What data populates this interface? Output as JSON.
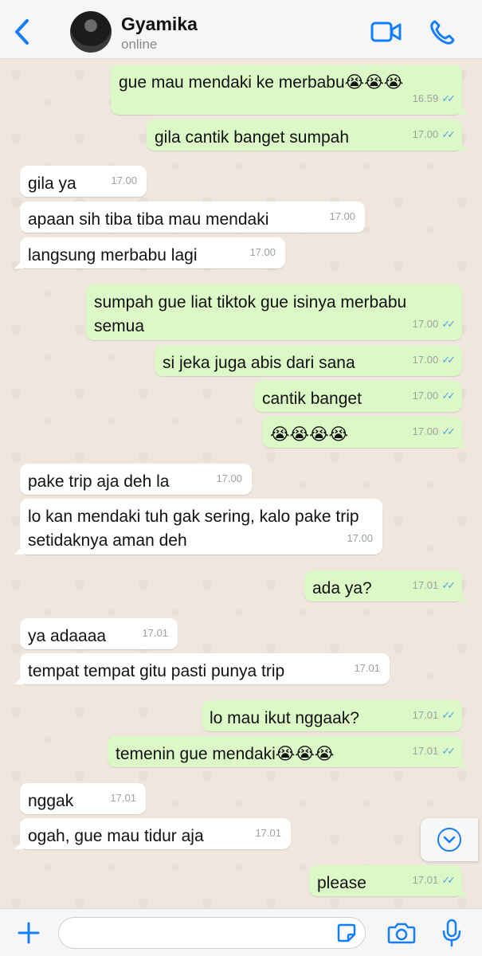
{
  "header": {
    "contact_name": "Gyamika",
    "status": "online",
    "icons": [
      "back-chevron-icon",
      "video-call-icon",
      "phone-call-icon"
    ]
  },
  "messages": [
    {
      "dir": "out",
      "text": "gue mau mendaki ke merbabu😭😭😭",
      "time": "16.59"
    },
    {
      "dir": "out",
      "text": "gila cantik banget sumpah",
      "time": "17.00"
    },
    {
      "dir": "in",
      "text": "gila ya",
      "time": "17.00"
    },
    {
      "dir": "in",
      "text": "apaan sih tiba tiba mau mendaki",
      "time": "17.00"
    },
    {
      "dir": "in",
      "text": "langsung merbabu lagi",
      "time": "17.00"
    },
    {
      "dir": "out",
      "text": "sumpah gue liat tiktok gue isinya merbabu semua",
      "time": "17.00"
    },
    {
      "dir": "out",
      "text": "si jeka juga abis dari sana",
      "time": "17.00"
    },
    {
      "dir": "out",
      "text": "cantik banget",
      "time": "17.00"
    },
    {
      "dir": "out",
      "text": "😭😭😭😭",
      "time": "17.00"
    },
    {
      "dir": "in",
      "text": "pake trip aja deh la",
      "time": "17.00"
    },
    {
      "dir": "in",
      "text": "lo kan mendaki tuh gak sering, kalo pake trip setidaknya aman deh",
      "time": "17.00"
    },
    {
      "dir": "out",
      "text": "ada ya?",
      "time": "17.01"
    },
    {
      "dir": "in",
      "text": "ya adaaaa",
      "time": "17.01"
    },
    {
      "dir": "in",
      "text": "tempat tempat gitu pasti punya trip",
      "time": "17.01"
    },
    {
      "dir": "out",
      "text": "lo mau ikut nggaak?",
      "time": "17.01"
    },
    {
      "dir": "out",
      "text": "temenin gue mendaki😭😭😭",
      "time": "17.01"
    },
    {
      "dir": "in",
      "text": "nggak",
      "time": "17.01"
    },
    {
      "dir": "in",
      "text": "ogah, gue mau tidur aja",
      "time": "17.01"
    },
    {
      "dir": "out",
      "text": "please",
      "time": "17.01"
    }
  ],
  "read_ticks": "✓✓",
  "colors": {
    "accent": "#147efb",
    "outgoing_bubble": "#dcf8c6",
    "incoming_bubble": "#ffffff",
    "read_ticks": "#53a3e6",
    "wallpaper": "#efe7de"
  },
  "footer": {
    "input_placeholder": "",
    "icons": [
      "plus-icon",
      "sticker-icon",
      "camera-icon",
      "microphone-icon"
    ]
  }
}
